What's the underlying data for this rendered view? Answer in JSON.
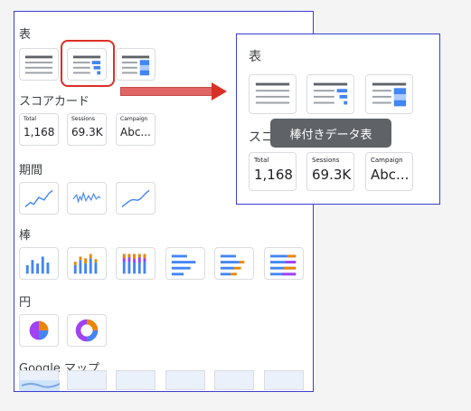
{
  "leftPanel": {
    "sections": {
      "table": "表",
      "scorecard": "スコアカード",
      "period": "期間",
      "bar": "棒",
      "pie": "円",
      "maps": "Google マップ"
    },
    "scorecards": [
      {
        "label": "Total",
        "value": "1,168"
      },
      {
        "label": "Sessions",
        "value": "69.3K"
      },
      {
        "label": "Campaign",
        "value": "Abc..."
      }
    ]
  },
  "rightPanel": {
    "title": "表",
    "tooltip": "棒付きデータ表",
    "scorecards": [
      {
        "label": "Total",
        "value": "1,168"
      },
      {
        "label": "Sessions",
        "value": "69.3K"
      },
      {
        "label": "Campaign",
        "value": "Abc..."
      }
    ],
    "scorecard_title_prefix": "スコ"
  },
  "colors": {
    "blue": "#4285f4",
    "orange": "#ea8600",
    "purple": "#a142f4",
    "red": "#d93025",
    "frame": "#3b3fd1"
  },
  "icons": [
    "table-icon",
    "bar-table-icon",
    "heatmap-table-icon",
    "timeseries-icon",
    "sparkline-icon",
    "smooth-line-icon",
    "column-chart-icon",
    "stacked-column-icon",
    "stacked-100-column-icon",
    "bar-chart-icon",
    "stacked-bar-icon",
    "stacked-100-bar-icon",
    "pie-icon",
    "donut-icon",
    "map-icon"
  ]
}
